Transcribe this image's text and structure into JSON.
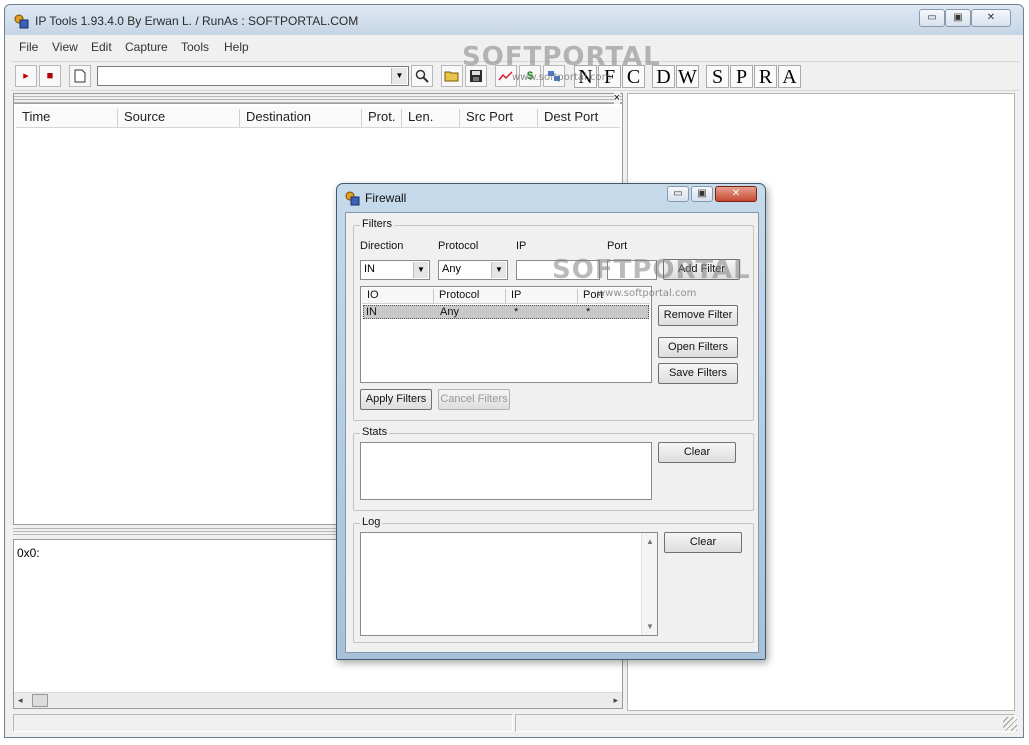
{
  "window": {
    "title": "IP Tools 1.93.4.0 By Erwan L. / RunAs : SOFTPORTAL.COM",
    "minimize_glyph": "▭",
    "maximize_glyph": "▣",
    "close_glyph": "✕"
  },
  "menu": [
    "File",
    "View",
    "Edit",
    "Capture",
    "Tools",
    "Help"
  ],
  "toolbar": {
    "url_value": "",
    "letter_buttons": [
      "N",
      "F",
      "C",
      "D",
      "W",
      "S",
      "P",
      "R",
      "A"
    ]
  },
  "packet_list": {
    "columns": [
      "Time",
      "Source",
      "Destination",
      "Prot.",
      "Len.",
      "Src Port",
      "Dest Port"
    ],
    "close_glyph": "×"
  },
  "hex_pane": {
    "text": "0x0:"
  },
  "watermark": {
    "brand": "SOFTPORTAL",
    "url": "www.softportal.com"
  },
  "firewall": {
    "title": "Firewall",
    "filters_group": "Filters",
    "direction_label": "Direction",
    "protocol_label": "Protocol",
    "ip_label": "IP",
    "port_label": "Port",
    "direction_value": "IN",
    "protocol_value": "Any",
    "ip_value": "",
    "port_value": "",
    "add_filter": "Add Filter",
    "remove_filter": "Remove Filter",
    "open_filters": "Open Filters",
    "save_filters": "Save Filters",
    "apply_filters": "Apply Filters",
    "cancel_filters": "Cancel Filters",
    "list_columns": [
      "IO",
      "Protocol",
      "IP",
      "Port"
    ],
    "rows": [
      {
        "io": "IN",
        "protocol": "Any",
        "ip": "*",
        "port": "*"
      }
    ],
    "stats_group": "Stats",
    "stats_clear": "Clear",
    "log_group": "Log",
    "log_clear": "Clear"
  }
}
